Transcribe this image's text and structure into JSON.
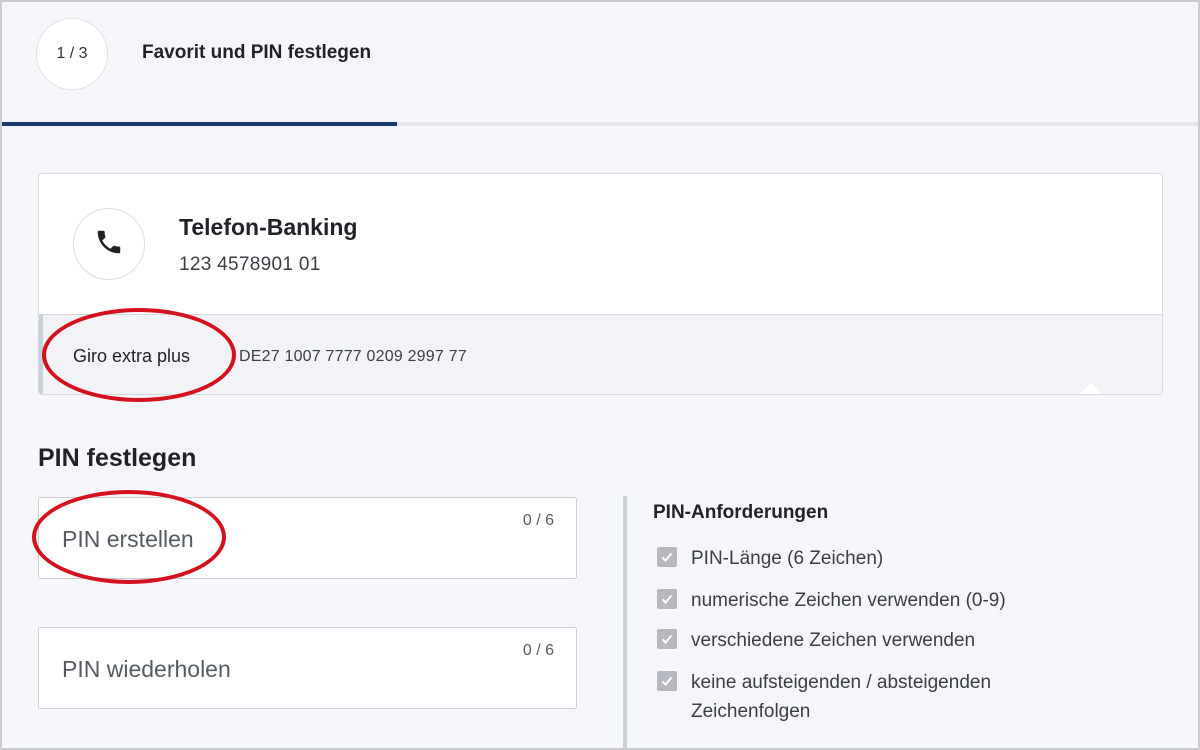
{
  "header": {
    "step_counter": "1 / 3",
    "title": "Favorit und PIN festlegen",
    "progress_fraction": 0.33
  },
  "account": {
    "name": "Telefon-Banking",
    "number": "123 4578901 01",
    "icon": "phone-icon",
    "product": "Giro extra plus",
    "iban": "DE27 1007 7777 0209 2997 77"
  },
  "pin_section": {
    "title": "PIN festlegen",
    "create_placeholder": "PIN erstellen",
    "create_counter": "0 / 6",
    "repeat_placeholder": "PIN wiederholen",
    "repeat_counter": "0 / 6"
  },
  "requirements": {
    "title": "PIN-Anforderungen",
    "items": [
      {
        "label": "PIN-Länge (6 Zeichen)",
        "checked": true
      },
      {
        "label": "numerische Zeichen verwenden (0-9)",
        "checked": true
      },
      {
        "label": "verschiedene Zeichen verwenden",
        "checked": true
      },
      {
        "label": "keine aufsteigenden / absteigenden Zeichenfolgen",
        "checked": true
      }
    ]
  },
  "colors": {
    "accent": "#1a3a6e",
    "highlight": "#d4121e",
    "background": "#f4f6f9"
  }
}
